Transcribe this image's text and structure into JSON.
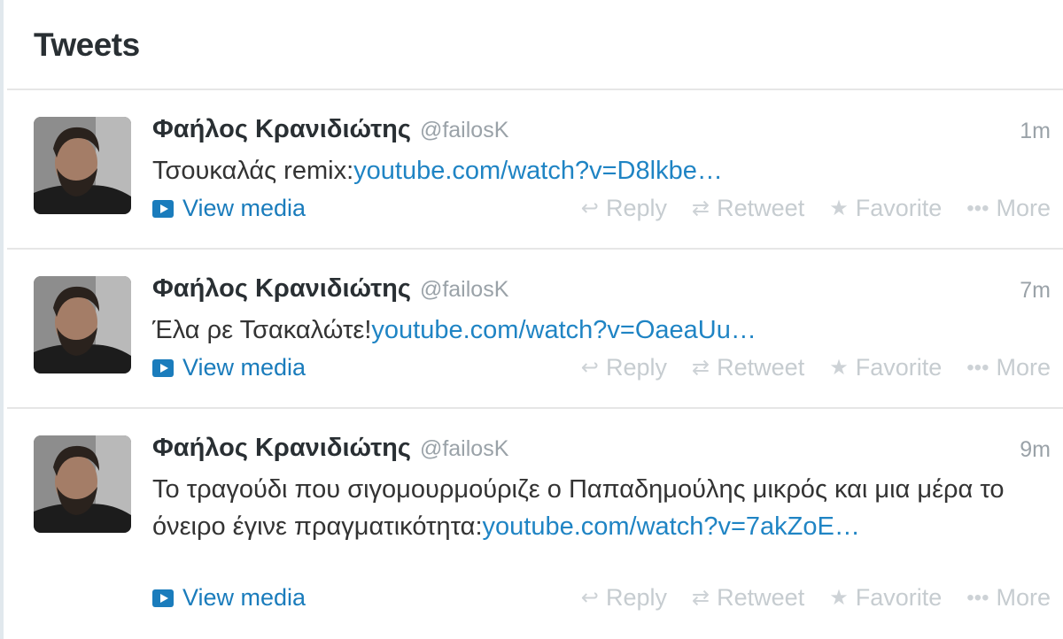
{
  "header": {
    "title": "Tweets"
  },
  "actions": {
    "reply": "Reply",
    "retweet": "Retweet",
    "favorite": "Favorite",
    "more": "More"
  },
  "media_label": "View media",
  "colors": {
    "link": "#1f84c4",
    "muted": "#9aa2a8",
    "action": "#c6ccd0"
  },
  "tweets": [
    {
      "fullname": "Φαήλος Κρανιδιώτης",
      "username": "@failosK",
      "time": "1m",
      "text": "Τσουκαλάς remix:",
      "link": "youtube.com/watch?v=D8lkbe…"
    },
    {
      "fullname": "Φαήλος Κρανιδιώτης",
      "username": "@failosK",
      "time": "7m",
      "text": "Έλα ρε Τσακαλώτε!",
      "link": "youtube.com/watch?v=OaeaUu…"
    },
    {
      "fullname": "Φαήλος Κρανιδιώτης",
      "username": "@failosK",
      "time": "9m",
      "text": "Το τραγούδι που σιγομουρμούριζε ο Παπαδημούλης μικρός και μια μέρα το όνειρο έγινε πραγματικότητα:",
      "link": "youtube.com/watch?v=7akZoE…"
    }
  ]
}
